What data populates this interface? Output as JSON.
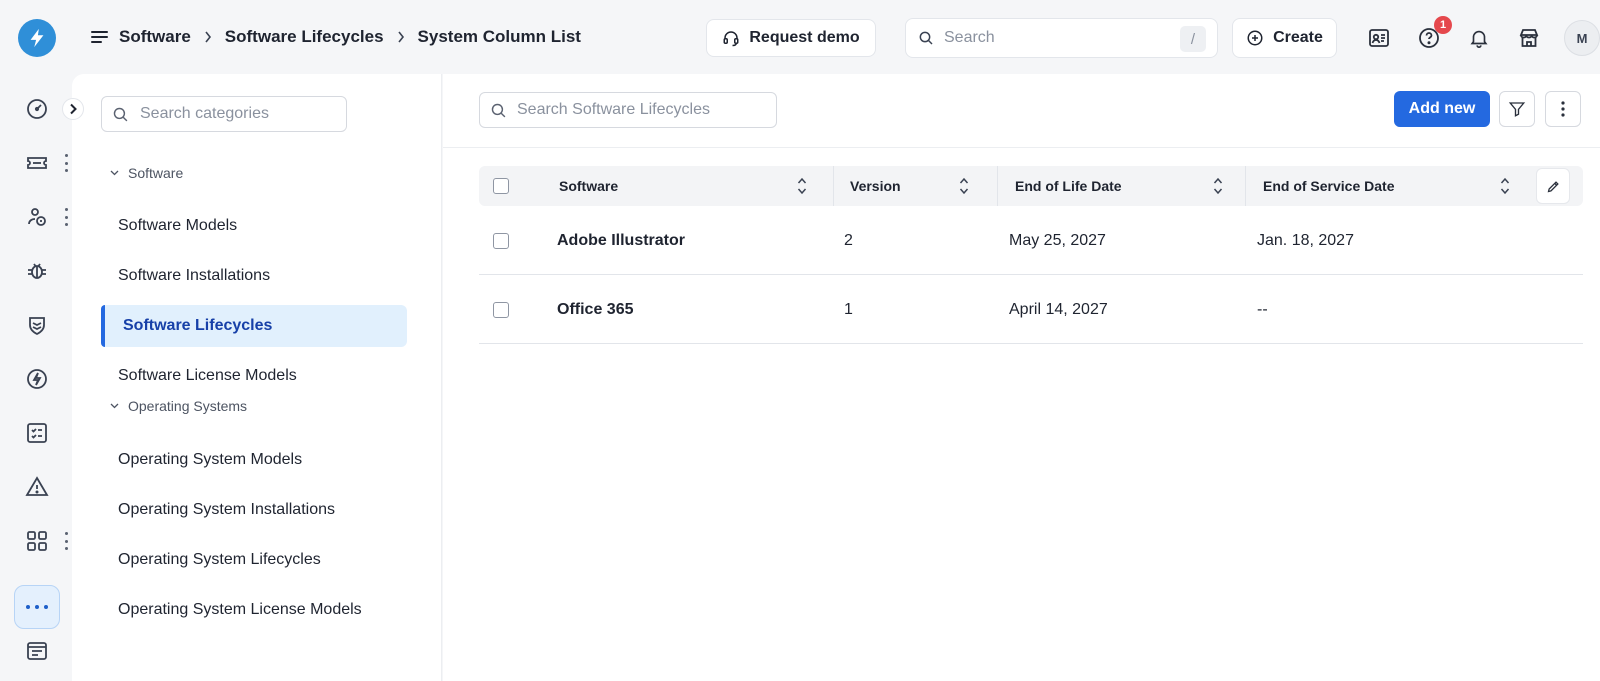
{
  "breadcrumbs": [
    "Software",
    "Software Lifecycles",
    "System Column List"
  ],
  "topbar": {
    "request_demo_label": "Request demo",
    "search_placeholder": "Search",
    "search_shortcut": "/",
    "create_label": "Create",
    "help_badge_count": "1",
    "avatar_initial": "M"
  },
  "categories": {
    "search_placeholder": "Search categories",
    "groups": [
      {
        "label": "Software",
        "items": [
          "Software Models",
          "Software Installations",
          "Software Lifecycles",
          "Software License Models"
        ]
      },
      {
        "label": "Operating Systems",
        "items": [
          "Operating System Models",
          "Operating System Installations",
          "Operating System Lifecycles",
          "Operating System License Models"
        ]
      }
    ],
    "active_item": "Software Lifecycles"
  },
  "main": {
    "search_placeholder": "Search Software Lifecycles",
    "add_new_label": "Add new"
  },
  "table": {
    "columns": [
      "Software",
      "Version",
      "End of Life Date",
      "End of Service Date"
    ],
    "rows": [
      {
        "software": "Adobe Illustrator",
        "version": "2",
        "end_of_life": "May 25, 2027",
        "end_of_service": "Jan. 18, 2027"
      },
      {
        "software": "Office 365",
        "version": "1",
        "end_of_life": "April 14, 2027",
        "end_of_service": "--"
      }
    ]
  },
  "colors": {
    "accent": "#2469e0",
    "logo": "#2f8fd8",
    "active_bg": "#e1f0fd",
    "badge": "#e5484d"
  }
}
